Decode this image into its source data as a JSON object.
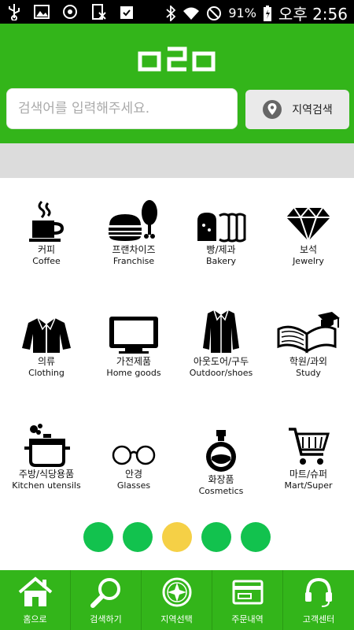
{
  "status_bar": {
    "battery_pct": "91%",
    "time": "오후 2:56"
  },
  "header": {
    "logo_text": "o2o",
    "search": {
      "placeholder": "검색어를 입력해주세요."
    },
    "region_button_label": "지역검색"
  },
  "colors": {
    "brand_green": "#33b51a",
    "dot_green": "#12c24e",
    "dot_active": "#f5d046"
  },
  "categories": [
    {
      "ko": "커피",
      "en": "Coffee",
      "icon": "coffee-cup-icon"
    },
    {
      "ko": "프랜차이즈",
      "en": "Franchise",
      "icon": "burger-chicken-icon"
    },
    {
      "ko": "빵/제과",
      "en": "Bakery",
      "icon": "bread-loaf-icon"
    },
    {
      "ko": "보석",
      "en": "Jewelry",
      "icon": "diamond-icon"
    },
    {
      "ko": "의류",
      "en": "Clothing",
      "icon": "jacket-icon"
    },
    {
      "ko": "가전제품",
      "en": "Home goods",
      "icon": "tv-icon"
    },
    {
      "ko": "아웃도어/구두",
      "en": "Outdoor/shoes",
      "icon": "coat-icon"
    },
    {
      "ko": "학원/과외",
      "en": "Study",
      "icon": "book-cap-icon"
    },
    {
      "ko": "주방/식당용품",
      "en": "Kitchen utensils",
      "icon": "cooking-pot-icon"
    },
    {
      "ko": "안경",
      "en": "Glasses",
      "icon": "glasses-icon"
    },
    {
      "ko": "화장품",
      "en": "Cosmetics",
      "icon": "perfume-icon"
    },
    {
      "ko": "마트/슈퍼",
      "en": "Mart/Super",
      "icon": "shopping-cart-icon"
    }
  ],
  "pager": {
    "count": 5,
    "active_index": 2
  },
  "bottom_nav": [
    {
      "label": "홈으로",
      "icon": "home-icon"
    },
    {
      "label": "검색하기",
      "icon": "magnifier-icon"
    },
    {
      "label": "지역선택",
      "icon": "compass-icon"
    },
    {
      "label": "주문내역",
      "icon": "card-icon"
    },
    {
      "label": "고객센터",
      "icon": "headset-icon"
    }
  ]
}
